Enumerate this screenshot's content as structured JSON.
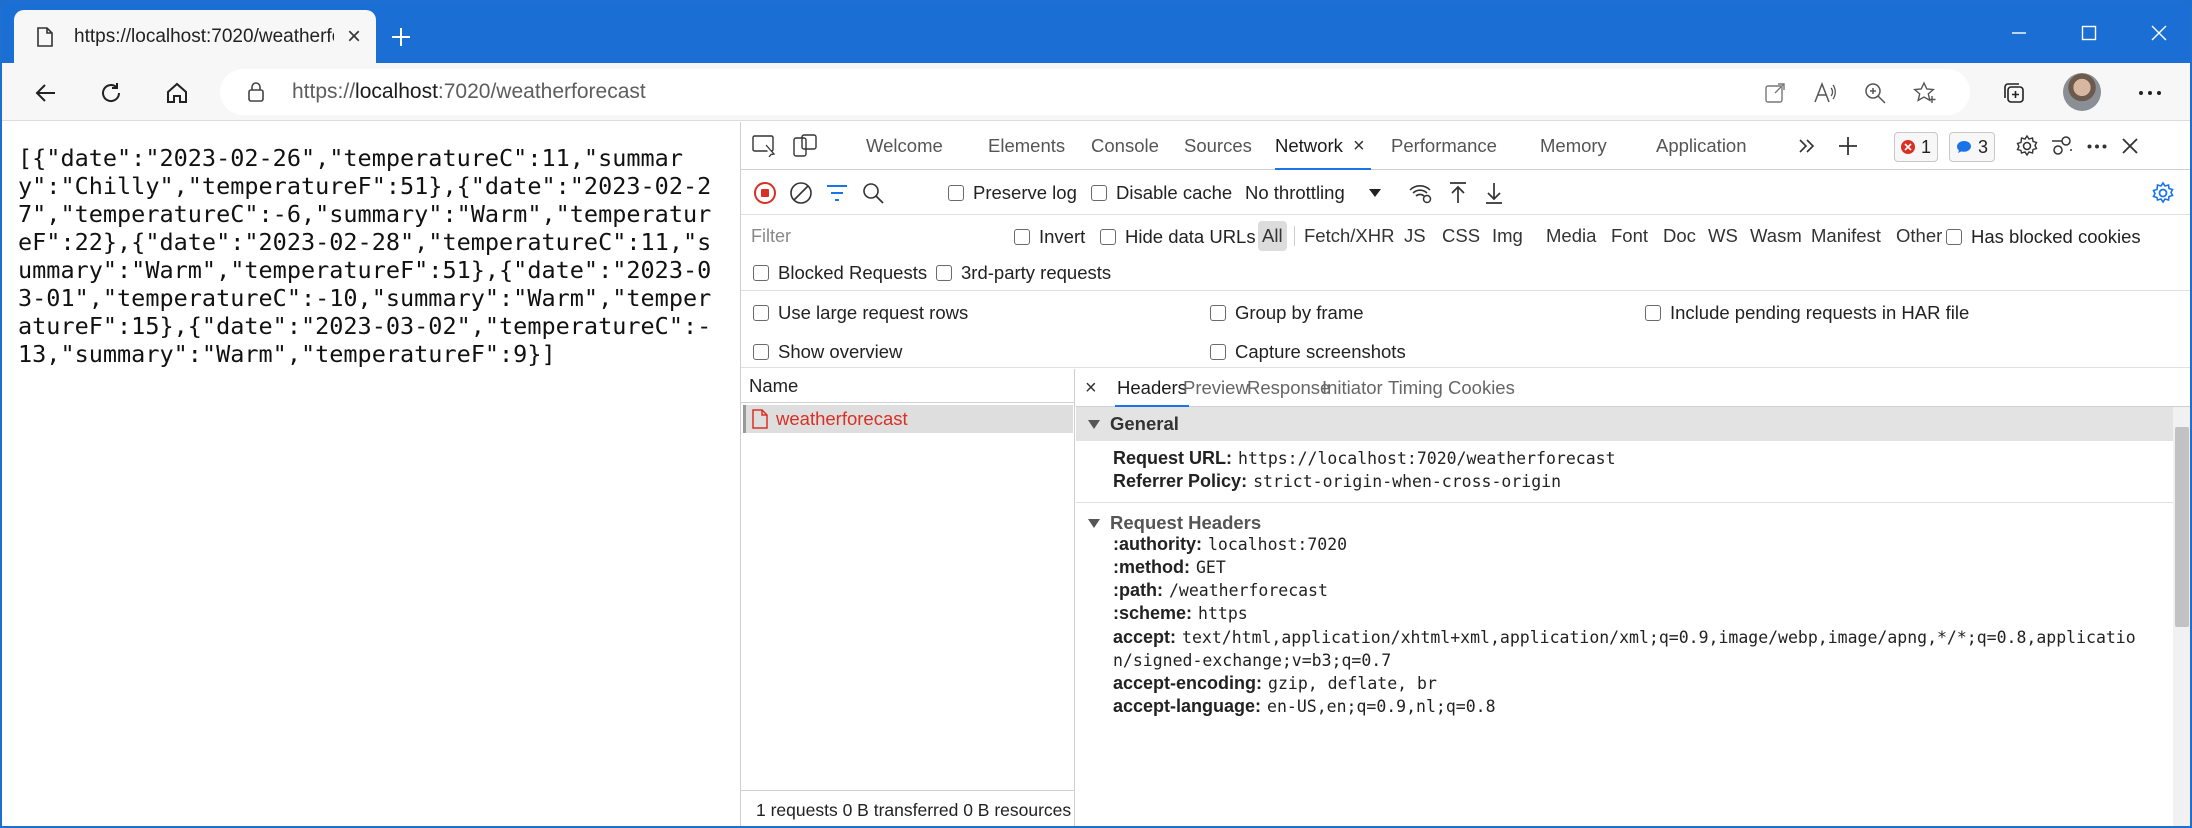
{
  "browser": {
    "tab_title": "https://localhost:7020/weatherfo",
    "address": {
      "prefix": "https://",
      "host": "localhost",
      "rest": ":7020/weatherforecast"
    }
  },
  "page": {
    "json_text": "[{\"date\":\"2023-02-26\",\"temperatureC\":11,\"summary\":\"Chilly\",\"temperatureF\":51},{\"date\":\"2023-02-27\",\"temperatureC\":-6,\"summary\":\"Warm\",\"temperatureF\":22},{\"date\":\"2023-02-28\",\"temperatureC\":11,\"summary\":\"Warm\",\"temperatureF\":51},{\"date\":\"2023-03-01\",\"temperatureC\":-10,\"summary\":\"Warm\",\"temperatureF\":15},{\"date\":\"2023-03-02\",\"temperatureC\":-13,\"summary\":\"Warm\",\"temperatureF\":9}]"
  },
  "devtools": {
    "tabs": [
      "Welcome",
      "Elements",
      "Console",
      "Sources",
      "Network",
      "Performance",
      "Memory",
      "Application"
    ],
    "errors": "1",
    "messages": "3",
    "toolbar": {
      "preserve_log": "Preserve log",
      "disable_cache": "Disable cache",
      "throttling": "No throttling"
    },
    "filter": {
      "placeholder": "Filter",
      "invert": "Invert",
      "hide_data_urls": "Hide data URLs",
      "types": [
        "All",
        "Fetch/XHR",
        "JS",
        "CSS",
        "Img",
        "Media",
        "Font",
        "Doc",
        "WS",
        "Wasm",
        "Manifest",
        "Other"
      ],
      "has_blocked_cookies": "Has blocked cookies",
      "blocked_requests": "Blocked Requests",
      "third_party": "3rd-party requests"
    },
    "settings": {
      "large_rows": "Use large request rows",
      "show_overview": "Show overview",
      "group_by_frame": "Group by frame",
      "capture_screenshots": "Capture screenshots",
      "include_pending": "Include pending requests in HAR file"
    },
    "requests": {
      "column_name": "Name",
      "rows": [
        "weatherforecast"
      ],
      "footer": "1 requests   0 B transferred   0 B resources"
    },
    "detail": {
      "tabs": [
        "Headers",
        "Preview",
        "Response",
        "Initiator",
        "Timing",
        "Cookies"
      ],
      "general_title": "General",
      "general": [
        {
          "k": "Request URL:",
          "v": "https://localhost:7020/weatherforecast"
        },
        {
          "k": "Referrer Policy:",
          "v": "strict-origin-when-cross-origin"
        }
      ],
      "request_headers_title": "Request Headers",
      "request_headers": [
        {
          "k": ":authority:",
          "v": "localhost:7020"
        },
        {
          "k": ":method:",
          "v": "GET"
        },
        {
          "k": ":path:",
          "v": "/weatherforecast"
        },
        {
          "k": ":scheme:",
          "v": "https"
        },
        {
          "k": "accept:",
          "v": "text/html,application/xhtml+xml,application/xml;q=0.9,image/webp,image/apng,*/*;q=0.8,applicatio"
        },
        {
          "k": "",
          "v": "n/signed-exchange;v=b3;q=0.7"
        },
        {
          "k": "accept-encoding:",
          "v": "gzip, deflate, br"
        },
        {
          "k": "accept-language:",
          "v": "en-US,en;q=0.9,nl;q=0.8"
        }
      ]
    }
  }
}
